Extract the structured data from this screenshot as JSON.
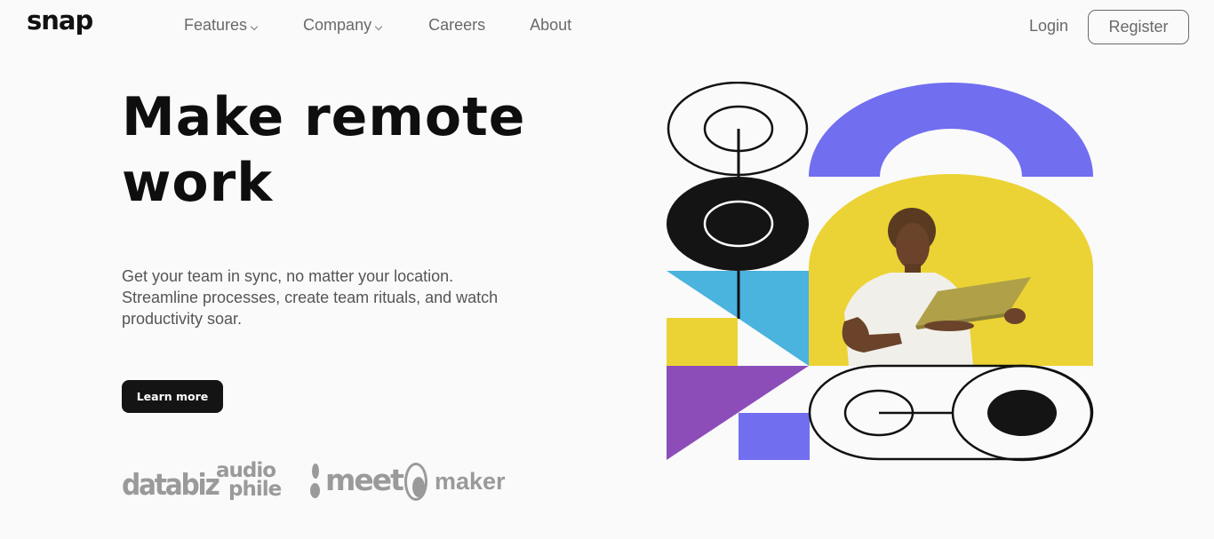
{
  "header": {
    "logo": "snap",
    "nav": [
      {
        "label": "Features",
        "has_dropdown": true
      },
      {
        "label": "Company",
        "has_dropdown": true
      },
      {
        "label": "Careers",
        "has_dropdown": false
      },
      {
        "label": "About",
        "has_dropdown": false
      }
    ],
    "login_label": "Login",
    "register_label": "Register"
  },
  "hero": {
    "title": "Make remote work",
    "description": "Get your team in sync, no matter your location. Streamline processes, create team rituals, and watch productivity soar.",
    "cta_label": "Learn more"
  },
  "clients": {
    "databiz": "databiz",
    "audiophile_line1": "audio",
    "audiophile_line2": "phile",
    "meet": "meet",
    "maker": "maker"
  },
  "colors": {
    "accent_purple": "#716ef0",
    "accent_yellow": "#ecd335",
    "accent_blue": "#4ab3de",
    "accent_violet": "#8c4db8",
    "dark": "#141414",
    "muted_text": "#696969"
  }
}
